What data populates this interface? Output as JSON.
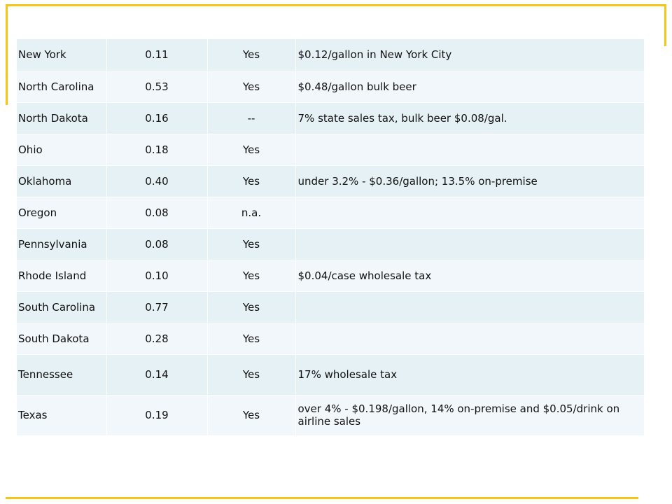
{
  "table": {
    "rows": [
      {
        "state": "New York",
        "rate": "0.11",
        "sales_tax": "Yes",
        "note": "$0.12/gallon in New York City"
      },
      {
        "state": "North Carolina",
        "rate": "0.53",
        "sales_tax": "Yes",
        "note": "$0.48/gallon bulk beer"
      },
      {
        "state": "North Dakota",
        "rate": "0.16",
        "sales_tax": "--",
        "note": "7% state sales tax, bulk beer $0.08/gal."
      },
      {
        "state": "Ohio",
        "rate": "0.18",
        "sales_tax": "Yes",
        "note": ""
      },
      {
        "state": "Oklahoma",
        "rate": "0.40",
        "sales_tax": "Yes",
        "note": "under 3.2% - $0.36/gallon; 13.5% on-premise"
      },
      {
        "state": "Oregon",
        "rate": "0.08",
        "sales_tax": "n.a.",
        "note": ""
      },
      {
        "state": "Pennsylvania",
        "rate": "0.08",
        "sales_tax": "Yes",
        "note": ""
      },
      {
        "state": "Rhode Island",
        "rate": "0.10",
        "sales_tax": "Yes",
        "note": "$0.04/case wholesale tax"
      },
      {
        "state": "South Carolina",
        "rate": "0.77",
        "sales_tax": "Yes",
        "note": ""
      },
      {
        "state": "South Dakota",
        "rate": "0.28",
        "sales_tax": "Yes",
        "note": ""
      },
      {
        "state": "Tennessee",
        "rate": "0.14",
        "sales_tax": "Yes",
        "note": "17% wholesale tax"
      },
      {
        "state": "Texas",
        "rate": "0.19",
        "sales_tax": "Yes",
        "note": "over 4% - $0.198/gallon, 14% on-premise and $0.05/drink on airline sales"
      }
    ]
  },
  "colors": {
    "frame_accent": "#f5c518",
    "row_band_dark": "#e6f1f5",
    "row_band_light": "#f1f7fa"
  }
}
